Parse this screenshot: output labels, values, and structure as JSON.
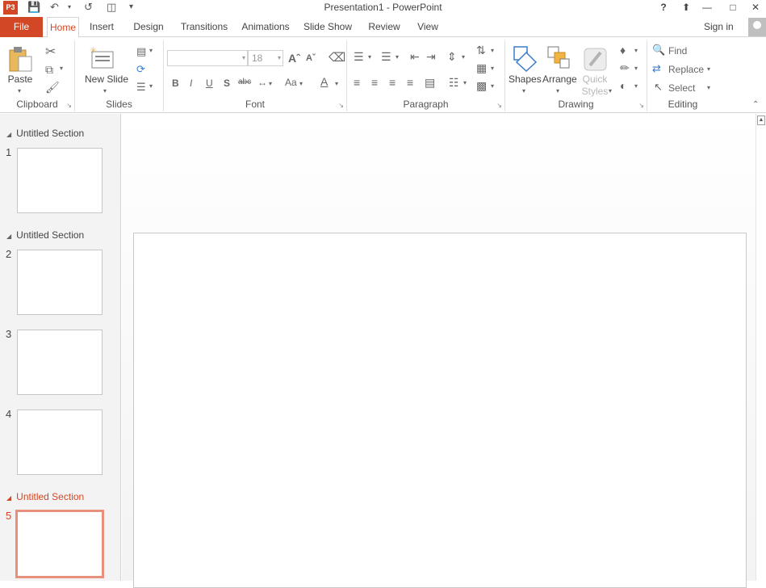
{
  "window": {
    "title": "Presentation1 - PowerPoint",
    "app_badge": "P3",
    "help": "?",
    "brand_color": "#d24726"
  },
  "tabs": {
    "file": "File",
    "items": [
      "Home",
      "Insert",
      "Design",
      "Transitions",
      "Animations",
      "Slide Show",
      "Review",
      "View"
    ],
    "active": "Home",
    "sign_in": "Sign in"
  },
  "ribbon": {
    "clipboard": {
      "label": "Clipboard",
      "paste": "Paste"
    },
    "slides": {
      "label": "Slides",
      "new_slide": "New Slide"
    },
    "font": {
      "label": "Font",
      "font_name": "",
      "font_size": "18",
      "case_btn": "Aa",
      "color_btn": "A",
      "char_btn": "A"
    },
    "paragraph": {
      "label": "Paragraph"
    },
    "drawing": {
      "label": "Drawing",
      "shapes": "Shapes",
      "arrange": "Arrange",
      "quick_styles": "Quick Styles"
    },
    "editing": {
      "label": "Editing",
      "find": "Find",
      "replace": "Replace",
      "select": "Select"
    }
  },
  "slides_pane": {
    "sections": [
      {
        "name": "Untitled Section",
        "active": false
      },
      {
        "name": "Untitled Section",
        "active": false
      },
      {
        "name": "Untitled Section",
        "active": true
      }
    ],
    "slide_numbers": [
      "1",
      "2",
      "3",
      "4",
      "5"
    ],
    "selected_slide": "5"
  }
}
